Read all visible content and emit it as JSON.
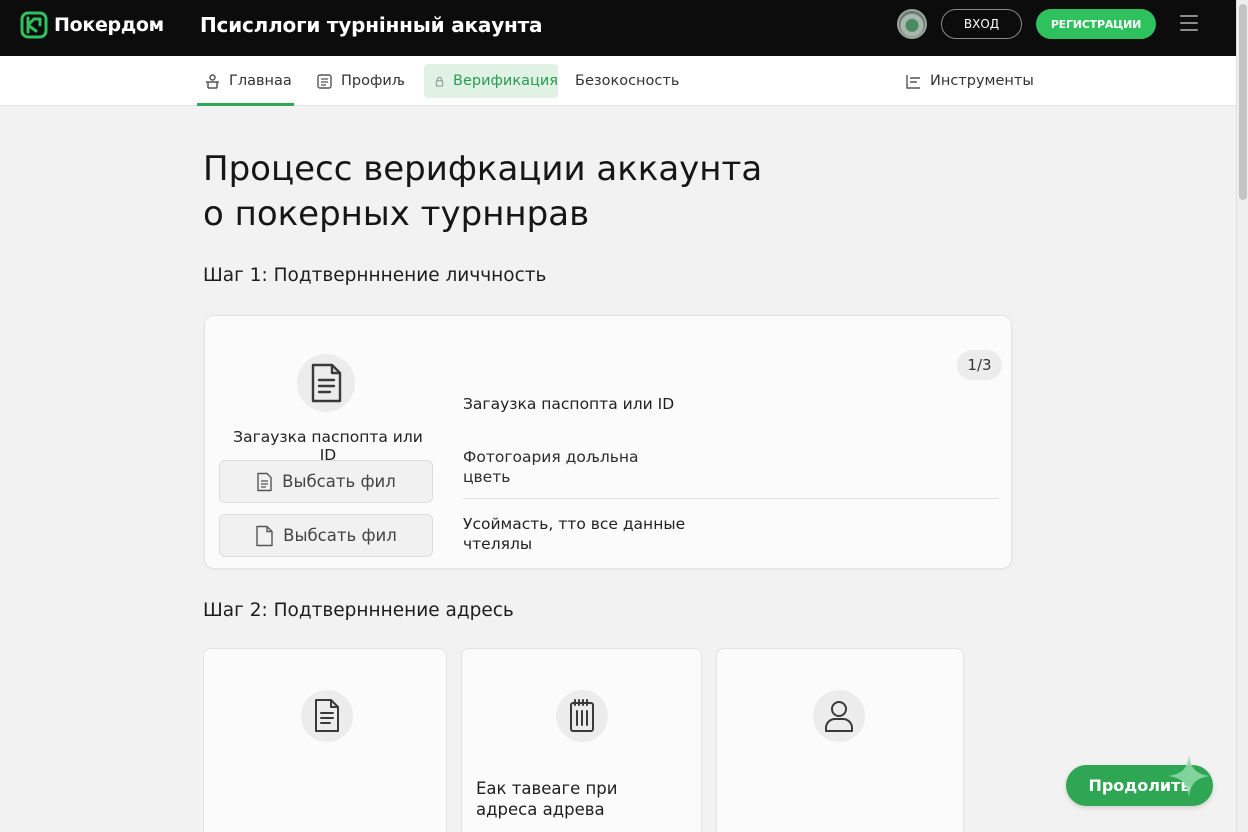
{
  "header": {
    "brand": "Покердом",
    "page_heading": "Псисллоги турнінный акаунта",
    "login_label": "ВХОД",
    "register_label": "РЕГИСТРАЦИИ",
    "brand_color": "#2fc15e"
  },
  "nav": {
    "items": [
      {
        "label": "Главнаа",
        "icon": "home-icon",
        "active": true
      },
      {
        "label": "Профиљ",
        "icon": "profile-icon",
        "active": false
      },
      {
        "label": "Верификация",
        "icon": "lock-icon",
        "active": true,
        "highlighted": true
      },
      {
        "label": "Безокосность",
        "icon": "",
        "active": false
      },
      {
        "label": "Инструменты",
        "icon": "tools-icon",
        "active": false
      }
    ]
  },
  "main": {
    "title_line1": "Процесс верифкации аккаунта",
    "title_line2": "о покерных турннрав",
    "step1": {
      "title": "Шаг 1: Подтвернннение личчность",
      "upload_label": "Загаузка паспопта или ID",
      "file_button_1": "Выбсать фил",
      "file_button_2": "Выбсать фил",
      "counter": "1/3",
      "info_1": "Загаузка паспопта или ID",
      "info_2": "Фотогоария дољльна цветь",
      "info_3": "Усоймасть, тто все данные чтелялы"
    },
    "step2": {
      "title": "Шаг 2: Подтвернннение адресь",
      "cards": [
        {
          "icon": "document-icon",
          "text": ""
        },
        {
          "icon": "clipboard-icon",
          "text": "Еак тавеаге при адреса адрева"
        },
        {
          "icon": "user-icon",
          "text": ""
        }
      ]
    },
    "continue_label": "Продолить"
  }
}
